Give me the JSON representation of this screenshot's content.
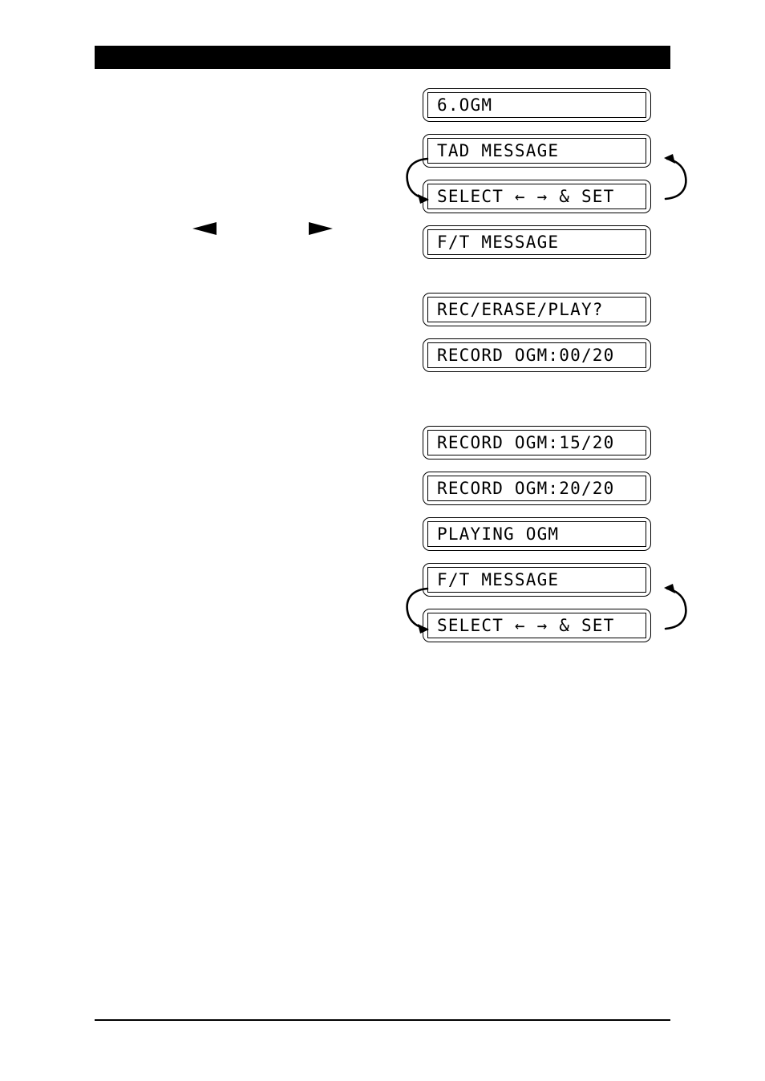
{
  "page": {
    "header_bar": {
      "label": "",
      "color": "#000000"
    },
    "footer_rule": {
      "color": "#000000"
    },
    "ink_color": "#000000",
    "paper_color": "#ffffff"
  },
  "cursors": {
    "left_triangle": "◀",
    "right_triangle": "▶"
  },
  "groups": [
    {
      "name": "group-1",
      "screens": [
        {
          "text": "6.OGM"
        },
        {
          "text": "TAD MESSAGE"
        },
        {
          "text": "SELECT ← → & SET"
        },
        {
          "text": "F/T MESSAGE"
        }
      ],
      "loop": {
        "left_arrow": "curved-arrow-down-left",
        "right_arrow": "curved-arrow-up-right"
      }
    },
    {
      "name": "group-2",
      "screens": [
        {
          "text": "REC/ERASE/PLAY?"
        },
        {
          "text": "RECORD OGM:00/20"
        }
      ]
    },
    {
      "name": "group-3",
      "screens": [
        {
          "text": "RECORD OGM:15/20"
        },
        {
          "text": "RECORD OGM:20/20"
        },
        {
          "text": "PLAYING OGM"
        },
        {
          "text": "F/T MESSAGE"
        },
        {
          "text": "SELECT ← → & SET"
        }
      ],
      "loop": {
        "left_arrow": "curved-arrow-down-left",
        "right_arrow": "curved-arrow-up-right"
      }
    }
  ]
}
